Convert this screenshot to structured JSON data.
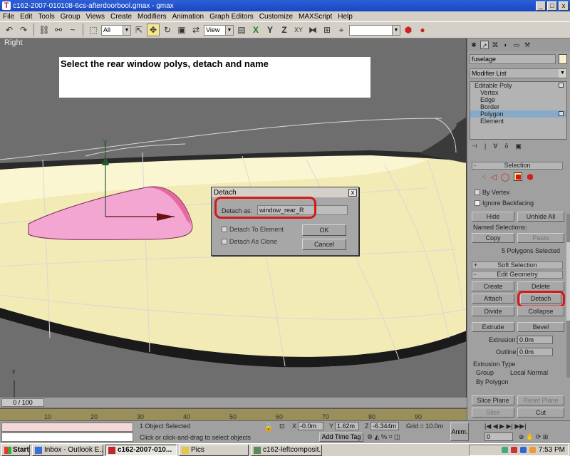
{
  "window": {
    "title": "c162-2007-010108-6cs-afterdoorbool.gmax - gmax",
    "min_label": "_",
    "max_label": "□",
    "close_label": "x"
  },
  "menu": [
    "File",
    "Edit",
    "Tools",
    "Group",
    "Views",
    "Create",
    "Modifiers",
    "Animation",
    "Graph Editors",
    "Customize",
    "MAXScript",
    "Help"
  ],
  "toolbar": {
    "selection_filter": "All",
    "reference_coord": "View",
    "named_selection": ""
  },
  "viewport": {
    "label": "Right",
    "instruction": "Select the rear window polys, detach and name",
    "axis_y": "y",
    "axis_z": "z"
  },
  "detach_dialog": {
    "title": "Detach",
    "close_label": "x",
    "detach_as_label": "Detach as:",
    "detach_as_value": "window_rear_R",
    "detach_to_element": "Detach To Element",
    "detach_as_clone": "Detach As Clone",
    "ok_label": "OK",
    "cancel_label": "Cancel"
  },
  "command_panel": {
    "object_name": "fuselage",
    "modifier_list": "Modifier List",
    "stack": [
      {
        "label": "Editable Poly",
        "level": "top"
      },
      {
        "label": "Vertex",
        "level": "sub"
      },
      {
        "label": "Edge",
        "level": "sub"
      },
      {
        "label": "Border",
        "level": "sub"
      },
      {
        "label": "Polygon",
        "level": "sub",
        "selected": true
      },
      {
        "label": "Element",
        "level": "sub"
      }
    ],
    "selection": {
      "title": "Selection",
      "sign": "-",
      "by_vertex": "By Vertex",
      "ignore_backfacing": "Ignore Backfacing",
      "hide": "Hide",
      "unhide_all": "Unhide All",
      "named_selections": "Named Selections:",
      "copy": "Copy",
      "paste": "Paste",
      "status": "5 Polygons Selected"
    },
    "soft_selection": {
      "title": "Soft Selection",
      "sign": "+"
    },
    "edit_geometry": {
      "title": "Edit Geometry",
      "sign": "-",
      "create": "Create",
      "delete": "Delete",
      "attach": "Attach",
      "detach": "Detach",
      "divide": "Divide",
      "collapse": "Collapse",
      "extrude": "Extrude",
      "bevel": "Bevel",
      "extrusion_label": "Extrusion:",
      "extrusion_value": "0.0m",
      "outline_label": "Outline",
      "outline_value": "0.0m",
      "extrusion_type": "Extrusion Type",
      "group": "Group",
      "local_normal": "Local Normal",
      "by_polygon": "By Polygon",
      "slice_plane": "Slice Plane",
      "reset_plane": "Reset Plane",
      "slice": "Slice",
      "cut": "Cut"
    }
  },
  "time": {
    "slider_label": "0 / 100",
    "ticks": [
      "10",
      "20",
      "30",
      "40",
      "50",
      "60",
      "70",
      "80",
      "90"
    ]
  },
  "status": {
    "objects_selected": "1 Object Selected",
    "prompt": "Click or click-and-drag to select objects",
    "x_label": "X",
    "x_value": "-0.0m",
    "y_label": "Y",
    "y_value": "1.62m",
    "z_label": "Z",
    "z_value": "-6.344m",
    "grid": "Grid = 10.0m",
    "add_time_tag": "Add Time Tag",
    "anim": "Anim.",
    "frame": "0"
  },
  "taskbar": {
    "start": "Start",
    "tasks": [
      "Inbox - Outlook E...",
      "c162-2007-010...",
      "Pics",
      "c162-leftcomposit..."
    ],
    "clock": "7:53 PM"
  }
}
